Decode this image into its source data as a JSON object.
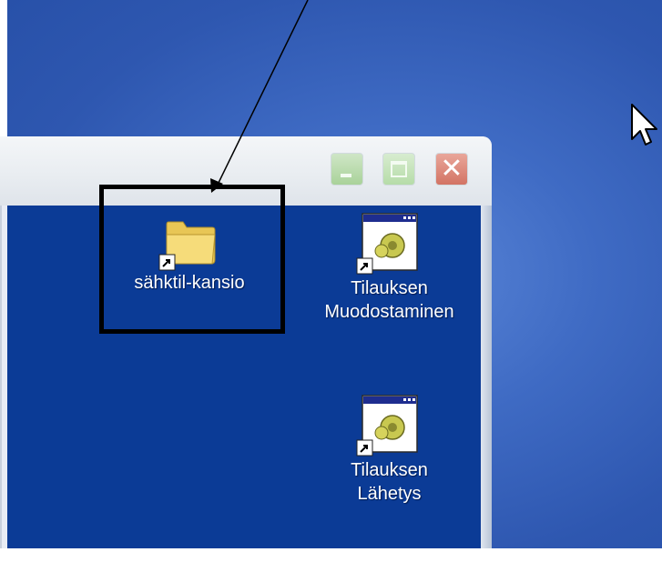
{
  "window": {
    "buttons": {
      "minimize_icon": "minimize-icon",
      "maximize_icon": "maximize-icon",
      "close_glyph": "✕"
    },
    "client_background": "#0b3b96"
  },
  "desktop": {
    "icons": [
      {
        "label": "sähktil-kansio",
        "icon": "folder-shortcut-icon"
      },
      {
        "label_line1": "Tilauksen",
        "label_line2": "Muodostaminen",
        "icon": "application-shortcut-icon"
      },
      {
        "label_line1": "Tilauksen",
        "label_line2": "Lähetys",
        "icon": "application-shortcut-icon"
      }
    ]
  },
  "annotation": {
    "highlight_color": "#000000",
    "arrow_color": "#000000"
  }
}
